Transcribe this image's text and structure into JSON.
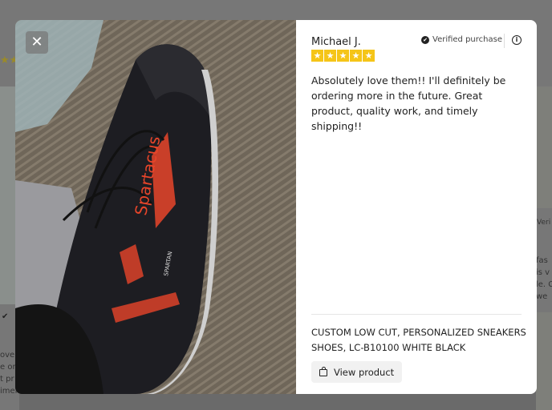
{
  "background": {
    "left_verified": "✔",
    "left_snippet": [
      "ove",
      "e on",
      "t pr",
      "imely"
    ],
    "right_verified": "Veri",
    "right_snippet": [
      "fas",
      "is v",
      "le. C",
      "we"
    ]
  },
  "modal": {
    "close_label": "✕",
    "reviewer_name": "Michael J.",
    "verified_label": "Verified purchase",
    "rating": 5,
    "review_text": "Absolutely love them!! I'll definitely be ordering more in the future. Great product, quality work, and timely shipping!!",
    "product_title": "CUSTOM LOW CUT, PERSONALIZED SNEAKERS SHOES, LC-B10100 WHITE BLACK",
    "view_product_label": "View product",
    "photo_text": {
      "brand": "Spartacus",
      "model": "SPARTAN"
    }
  },
  "colors": {
    "star": "#f5c518",
    "accent_red": "#e8452a"
  }
}
